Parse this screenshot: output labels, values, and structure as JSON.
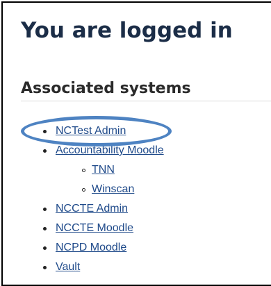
{
  "page": {
    "title": "You are logged in",
    "section_title": "Associated systems"
  },
  "systems": [
    {
      "label": "NCTest Admin"
    },
    {
      "label": "Accountability Moodle",
      "children": [
        {
          "label": "TNN"
        },
        {
          "label": "Winscan"
        }
      ]
    },
    {
      "label": "NCCTE Admin"
    },
    {
      "label": "NCCTE Moodle"
    },
    {
      "label": "NCPD Moodle"
    },
    {
      "label": "Vault"
    }
  ],
  "colors": {
    "link": "#1f4a8a",
    "heading": "#1b2d47",
    "highlight": "#4e83c2"
  }
}
